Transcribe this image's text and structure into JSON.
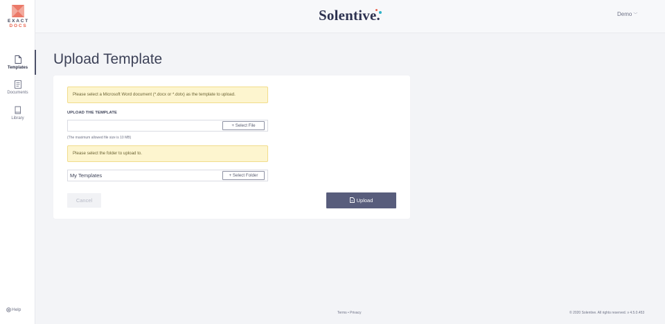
{
  "sidebar": {
    "logo": {
      "line1": "EXACT",
      "line2": "DOCS"
    },
    "items": [
      {
        "label": "Templates",
        "icon": "file-icon",
        "active": true
      },
      {
        "label": "Documents",
        "icon": "document-icon",
        "active": false
      },
      {
        "label": "Library",
        "icon": "book-icon",
        "active": false
      }
    ],
    "help_label": "Help"
  },
  "header": {
    "brand": "Solentive.",
    "user_label": "Demo"
  },
  "page": {
    "title": "Upload Template"
  },
  "form": {
    "file_alert": "Please select a Microsoft Word document (*.docx or *.dotx) as the template to upload.",
    "section_label": "UPLOAD THE TEMPLATE",
    "file_value": "",
    "select_file_label": "+ Select File",
    "size_hint": "(The maximum allowed file size is 10 MB)",
    "folder_alert": "Please select the folder to upload to.",
    "folder_value": "My Templates",
    "select_folder_label": "+ Select Folder",
    "cancel_label": "Cancel",
    "upload_label": "Upload"
  },
  "footer": {
    "links": "Terms • Privacy",
    "copyright": "© 2020 Solentive. All rights reserved. v 4.5.0.453"
  },
  "colors": {
    "accent": "#585d7c",
    "alert_bg": "#fdf5cf",
    "logo_orange": "#e8624d",
    "brand_teal": "#2fb3c8"
  }
}
